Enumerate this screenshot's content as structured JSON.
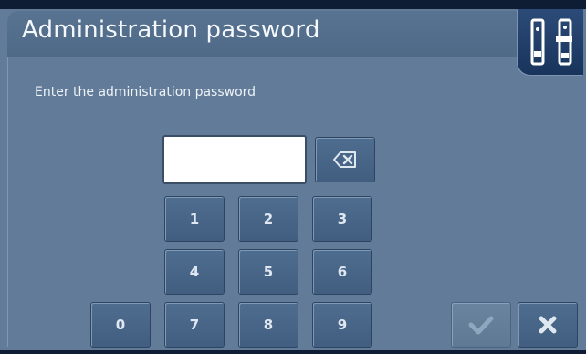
{
  "window": {
    "title": "Administration password"
  },
  "prompt": "Enter the administration password",
  "password": {
    "value": "",
    "placeholder": ""
  },
  "keypad": {
    "k1": "1",
    "k2": "2",
    "k3": "3",
    "k4": "4",
    "k5": "5",
    "k6": "6",
    "k7": "7",
    "k8": "8",
    "k9": "9",
    "k0": "0"
  },
  "icons": {
    "backspace": "backspace-icon",
    "confirm": "check-icon",
    "cancel": "close-icon",
    "corner": "keyboard-switch-icon"
  },
  "colors": {
    "background": "#617b98",
    "key": "#4a678a",
    "frame": "#0f1d34",
    "corner": "#1f3d68"
  }
}
